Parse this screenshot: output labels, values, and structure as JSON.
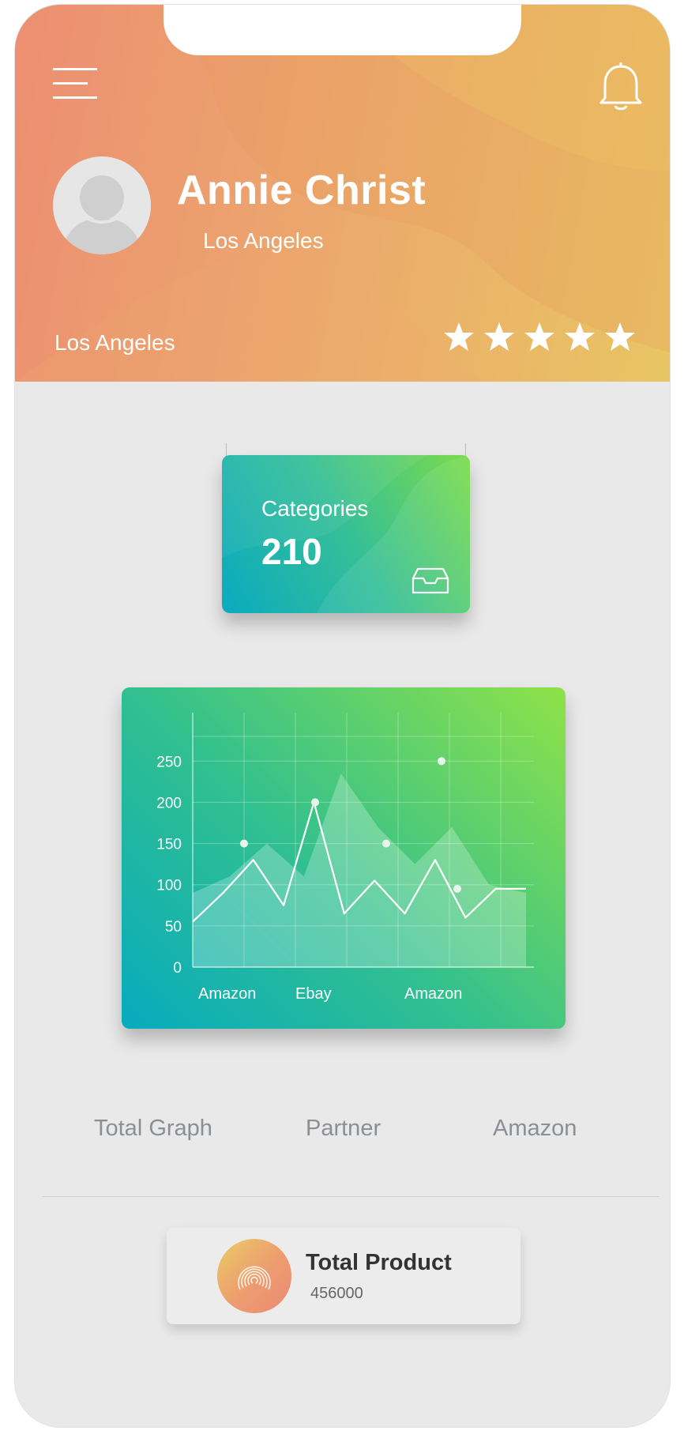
{
  "profile": {
    "name": "Annie Christ",
    "subtitle": "Los Angeles",
    "location": "Los Angeles",
    "rating": 5,
    "max_rating": 5
  },
  "categories": {
    "label": "Categories",
    "value": "210"
  },
  "chart_data": {
    "type": "area",
    "title": "",
    "xlabel": "",
    "ylabel": "",
    "ylim": [
      0,
      280
    ],
    "grid": true,
    "x_tick_labels": [
      "Amazon",
      "Ebay",
      "Amazon"
    ],
    "y_ticks": [
      0,
      50,
      100,
      150,
      200,
      250
    ],
    "series": [
      {
        "values": [
          90,
          110,
          150,
          110,
          235,
          170,
          125,
          170,
          100,
          90
        ]
      },
      {
        "values": [
          55,
          90,
          130,
          75,
          200,
          65,
          105,
          65,
          130,
          60,
          95,
          95
        ]
      }
    ],
    "markers": [
      150,
      200,
      150,
      250,
      95
    ]
  },
  "tabs": [
    "Total Graph",
    "Partner",
    "Amazon"
  ],
  "total_product": {
    "title": "Total Product",
    "value": "456000"
  },
  "icons": {
    "menu": "menu-icon",
    "bell": "bell-icon",
    "avatar": "user-avatar-icon",
    "star": "star-icon",
    "inbox": "inbox-tray-icon",
    "total": "fingerprint-icon"
  },
  "colors": {
    "header_start": "#ec8e72",
    "header_end": "#e8c563",
    "card_start": "#0aaabf",
    "card_end": "#7bdc4a",
    "tab_text": "#8b8f94"
  }
}
